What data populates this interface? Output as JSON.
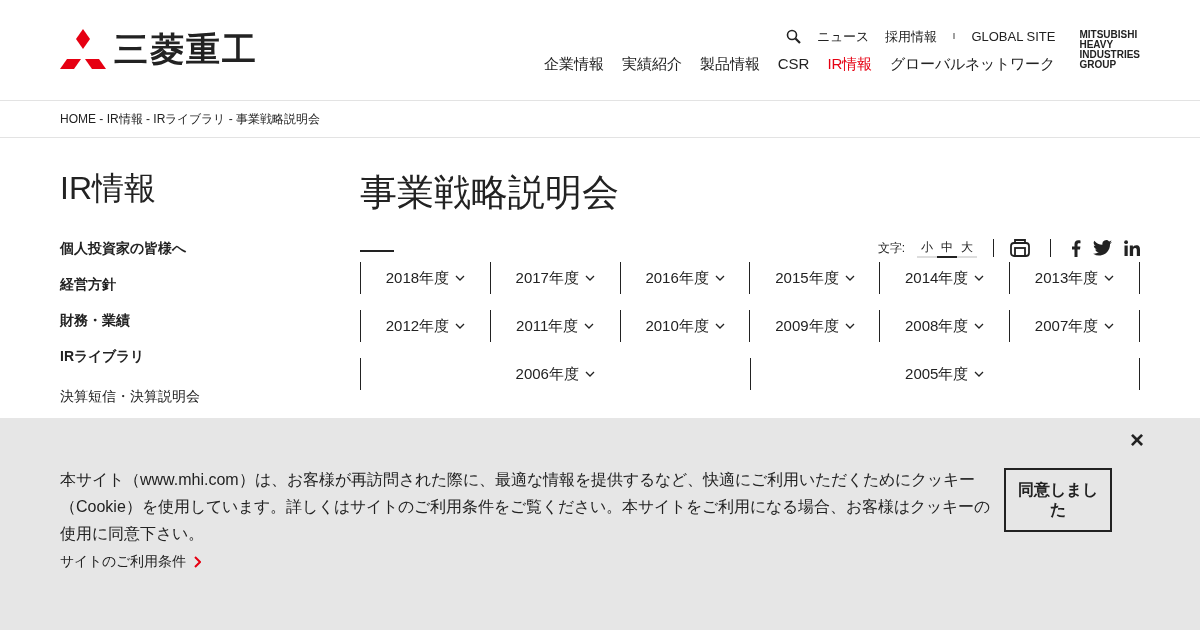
{
  "header": {
    "logo_text": "三菱重工",
    "utility_links": [
      {
        "label": "ニュース"
      },
      {
        "label": "採用情報"
      },
      {
        "label": "GLOBAL SITE"
      }
    ],
    "separator": "I",
    "nav": [
      {
        "label": "企業情報",
        "selected": false
      },
      {
        "label": "実績紹介",
        "selected": false
      },
      {
        "label": "製品情報",
        "selected": false
      },
      {
        "label": "CSR",
        "selected": false
      },
      {
        "label": "IR情報",
        "selected": true
      },
      {
        "label": "グローバルネットワーク",
        "selected": false
      }
    ],
    "group_logo": [
      "MITSUBISHI",
      "HEAVY",
      "INDUSTRIES",
      "GROUP"
    ]
  },
  "breadcrumb": "HOME - IR情報 - IRライブラリ - 事業戦略説明会",
  "sidebar": {
    "title": "IR情報",
    "items": [
      {
        "label": "個人投資家の皆様へ",
        "bold": true
      },
      {
        "label": "経営方針",
        "bold": true
      },
      {
        "label": "財務・業績",
        "bold": true
      },
      {
        "label": "IRライブラリ",
        "bold": true
      },
      {
        "label": "決算短信・決算説明会",
        "bold": false
      }
    ]
  },
  "main": {
    "title": "事業戦略説明会",
    "text_size": {
      "label": "文字:",
      "options": [
        {
          "label": "小",
          "selected": false
        },
        {
          "label": "中",
          "selected": true
        },
        {
          "label": "大",
          "selected": false
        }
      ]
    },
    "year_rows": [
      [
        "2018年度",
        "2017年度",
        "2016年度",
        "2015年度",
        "2014年度",
        "2013年度"
      ],
      [
        "2012年度",
        "2011年度",
        "2010年度",
        "2009年度",
        "2008年度",
        "2007年度"
      ],
      [
        "2006年度",
        "2005年度"
      ]
    ]
  },
  "cookie_banner": {
    "message": "本サイト（www.mhi.com）は、お客様が再訪問された際に、最適な情報を提供するなど、快適にご利用いただくためにクッキー（Cookie）を使用しています。詳しくはサイトのご利用条件をご覧ください。本サイトをご利用になる場合、お客様はクッキーの使用に同意下さい。",
    "link": "サイトのご利用条件",
    "accept": "同意しました",
    "close": "×"
  }
}
